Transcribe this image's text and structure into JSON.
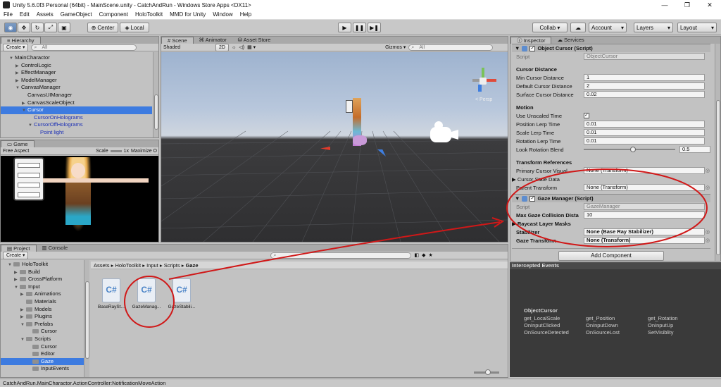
{
  "window": {
    "title": "Unity 5.6.0f3 Personal (64bit) - MainScene.unity - CatchAndRun - Windows Store Apps <DX11>",
    "controls": [
      "—",
      "❐",
      "✕"
    ]
  },
  "menu": [
    "File",
    "Edit",
    "Assets",
    "GameObject",
    "Component",
    "HoloToolkit",
    "MMD for Unity",
    "Window",
    "Help"
  ],
  "toolbar": {
    "center": "Center",
    "local": "Local",
    "collab": "Collab ▾",
    "account": "Account",
    "layers": "Layers",
    "layout": "Layout"
  },
  "hierarchy": {
    "tab": "Hierarchy",
    "create": "Create ▾",
    "search_placeholder": "All",
    "items": [
      {
        "label": "MainCharactor",
        "arrow": "▼",
        "indent": 0
      },
      {
        "label": "ControlLogic",
        "arrow": "▶",
        "indent": 1
      },
      {
        "label": "EffectManager",
        "arrow": "▶",
        "indent": 1
      },
      {
        "label": "ModelManager",
        "arrow": "▶",
        "indent": 1
      },
      {
        "label": "CanvasManager",
        "arrow": "▼",
        "indent": 1
      },
      {
        "label": "CanvasUIManager",
        "arrow": "",
        "indent": 2
      },
      {
        "label": "CanvasScaleObject",
        "arrow": "▶",
        "indent": 2
      },
      {
        "label": "Cursor",
        "arrow": "▼",
        "indent": 2,
        "selected": true
      },
      {
        "label": "CursorOnHolograms",
        "arrow": "",
        "indent": 3,
        "blue": true
      },
      {
        "label": "CursorOffHolograms",
        "arrow": "▼",
        "indent": 3,
        "blue": true
      },
      {
        "label": "Point light",
        "arrow": "",
        "indent": 4,
        "blue": true
      }
    ]
  },
  "game": {
    "tab": "Game",
    "aspect": "Free Aspect",
    "scale_label": "Scale",
    "scale_value": "1x",
    "maximize": "Maximize O"
  },
  "scene": {
    "tabs": [
      "Scene",
      "Animator",
      "Asset Store"
    ],
    "shaded": "Shaded",
    "mode2d": "2D",
    "gizmos": "Gizmos ▾",
    "search_placeholder": "All",
    "persp": "< Persp"
  },
  "project": {
    "tabs": [
      "Project",
      "Console"
    ],
    "create": "Create ▾",
    "breadcrumb": [
      "Assets",
      "HoloToolkit",
      "Input",
      "Scripts",
      "Gaze"
    ],
    "tree": [
      {
        "label": "HoloToolkit",
        "arrow": "▼",
        "indent": 0
      },
      {
        "label": "Build",
        "arrow": "▶",
        "indent": 1
      },
      {
        "label": "CrossPlatform",
        "arrow": "▶",
        "indent": 1
      },
      {
        "label": "Input",
        "arrow": "▼",
        "indent": 1
      },
      {
        "label": "Animations",
        "arrow": "▶",
        "indent": 2
      },
      {
        "label": "Materials",
        "arrow": "",
        "indent": 2
      },
      {
        "label": "Models",
        "arrow": "▶",
        "indent": 2
      },
      {
        "label": "Plugins",
        "arrow": "▶",
        "indent": 2
      },
      {
        "label": "Prefabs",
        "arrow": "▼",
        "indent": 2
      },
      {
        "label": "Cursor",
        "arrow": "",
        "indent": 3
      },
      {
        "label": "Scripts",
        "arrow": "▼",
        "indent": 2
      },
      {
        "label": "Cursor",
        "arrow": "",
        "indent": 3
      },
      {
        "label": "Editor",
        "arrow": "",
        "indent": 3
      },
      {
        "label": "Gaze",
        "arrow": "",
        "indent": 3,
        "selected": true
      },
      {
        "label": "InputEvents",
        "arrow": "",
        "indent": 3
      }
    ],
    "files": [
      "BaseRaySt...",
      "GazeManag...",
      "GazeStabili..."
    ]
  },
  "inspector": {
    "tabs": [
      "Inspector",
      "Services"
    ],
    "object_cursor": {
      "title": "Object Cursor (Script)",
      "script_label": "Script",
      "script_value": "ObjectCursor"
    },
    "cursor_distance": {
      "header": "Cursor Distance",
      "rows": [
        {
          "label": "Min Cursor Distance",
          "value": "1"
        },
        {
          "label": "Default Cursor Distance",
          "value": "2"
        },
        {
          "label": "Surface Cursor Distance",
          "value": "0.02"
        }
      ]
    },
    "motion": {
      "header": "Motion",
      "unscaled": "Use Unscaled Time",
      "rows": [
        {
          "label": "Position Lerp Time",
          "value": "0.01"
        },
        {
          "label": "Scale Lerp Time",
          "value": "0.01"
        },
        {
          "label": "Rotation Lerp Time",
          "value": "0.01"
        }
      ],
      "blend_label": "Look Rotation Blend",
      "blend_value": "0.5"
    },
    "transform_refs": {
      "header": "Transform References",
      "primary_label": "Primary Cursor Visual",
      "primary_value": "None (Transform)",
      "state_label": "Cursor State Data",
      "parent_label": "Parent Transform",
      "parent_value": "None (Transform)"
    },
    "gaze_manager": {
      "title": "Gaze Manager (Script)",
      "script_label": "Script",
      "script_value": "GazeManager",
      "max_label": "Max Gaze Collision Dista",
      "max_value": "10",
      "raycast_label": "Raycast Layer Masks",
      "stabilizer_label": "Stabilizer",
      "stabilizer_value": "None (Base Ray Stabilizer)",
      "gaze_transform_label": "Gaze Transform",
      "gaze_transform_value": "None (Transform)"
    },
    "add_component": "Add Component"
  },
  "events": {
    "title": "Intercepted Events",
    "header": "ObjectCursor",
    "items": [
      "get_LocalScale",
      "get_Position",
      "get_Rotation",
      "OnInputClicked",
      "OnInputDown",
      "OnInputUp",
      "OnSourceDetected",
      "OnSourceLost",
      "SetVisiblity"
    ]
  },
  "status": "CatchAndRun.MainCharactor.ActionController:NotificationMoveAction",
  "colors": {
    "selection": "#3d7be0",
    "annotation": "#d01818",
    "scene_sky": "#a8bcd8",
    "scene_ground": "#3a3a3c"
  }
}
